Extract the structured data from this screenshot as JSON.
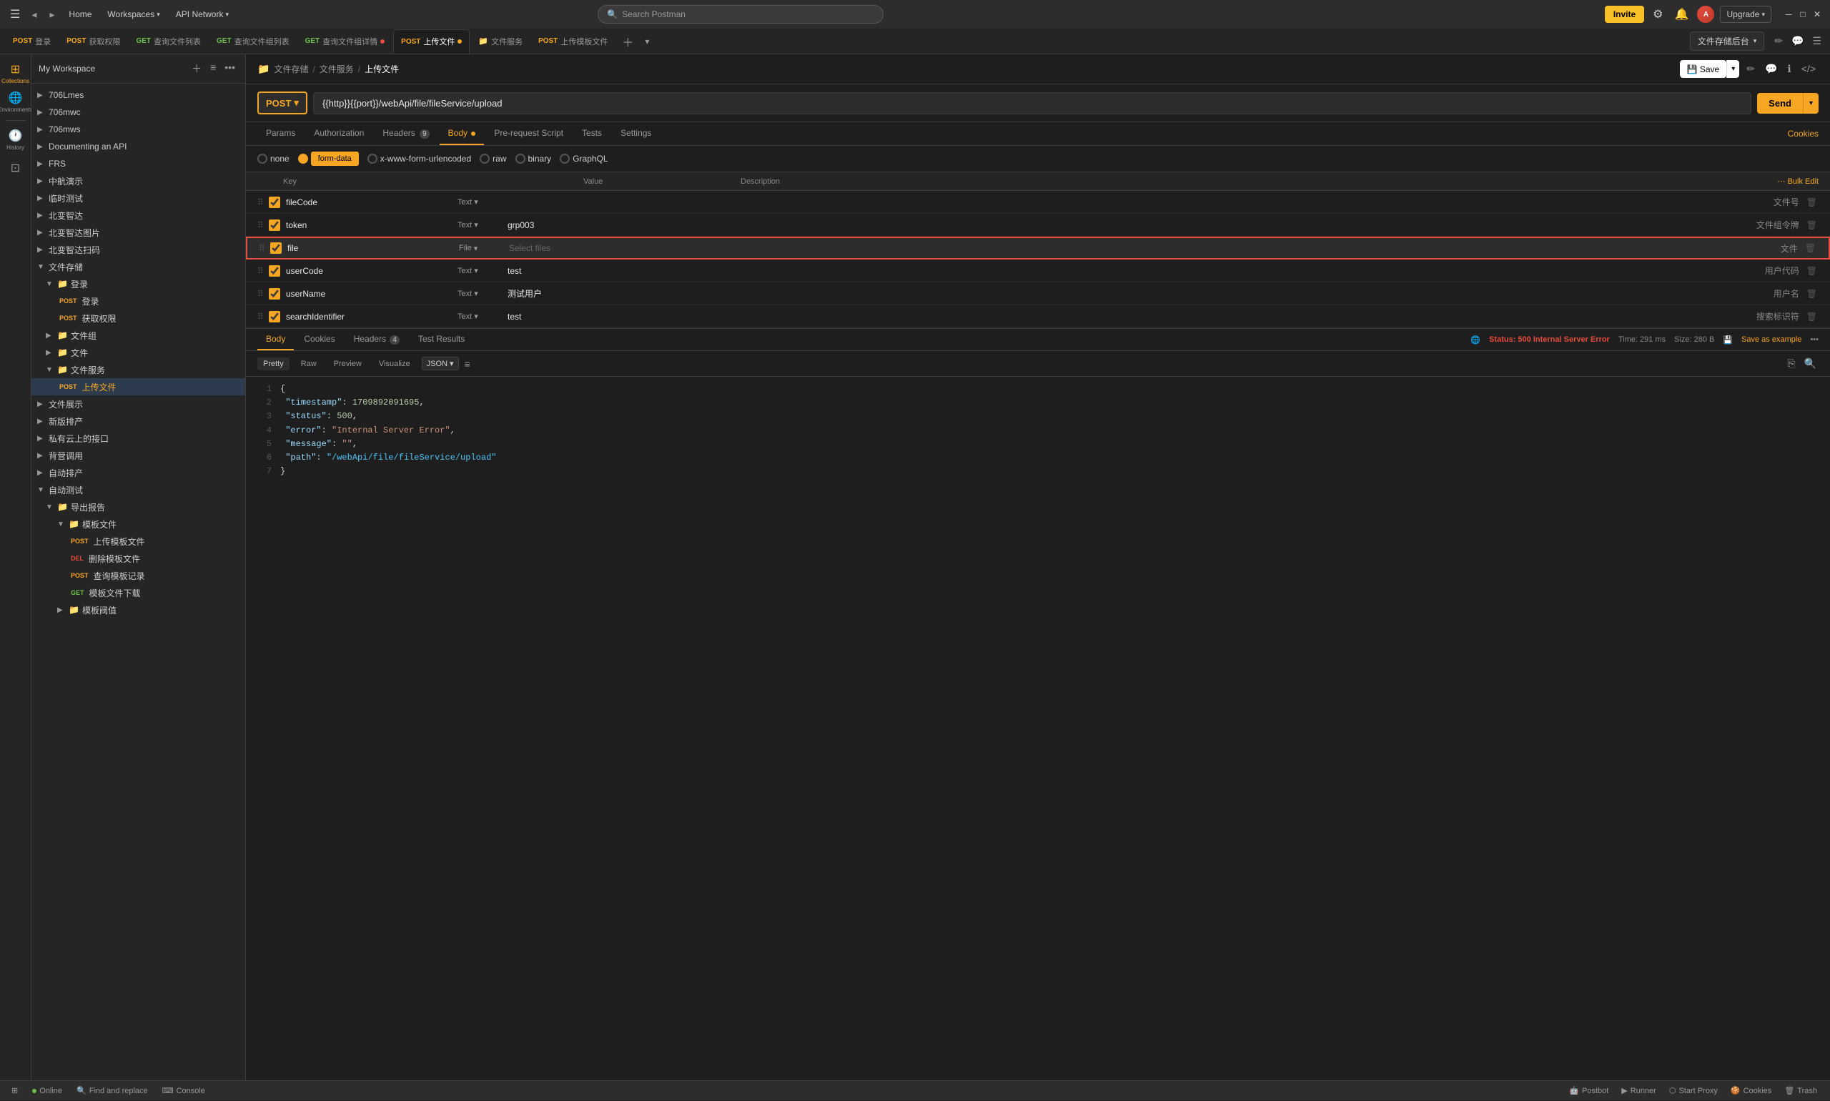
{
  "topbar": {
    "home_label": "Home",
    "workspaces_label": "Workspaces",
    "api_network_label": "API Network",
    "search_placeholder": "Search Postman",
    "invite_label": "Invite",
    "upgrade_label": "Upgrade"
  },
  "tabs": [
    {
      "method": "POST",
      "method_class": "post",
      "name": "登录",
      "active": false
    },
    {
      "method": "POST",
      "method_class": "post",
      "name": "获取权限",
      "active": false
    },
    {
      "method": "GET",
      "method_class": "get",
      "name": "查询文件列表",
      "active": false
    },
    {
      "method": "GET",
      "method_class": "get",
      "name": "查询文件组列表",
      "active": false
    },
    {
      "method": "GET",
      "method_class": "get",
      "name": "查询文件组详情",
      "active": false,
      "has_dot": true
    },
    {
      "method": "POST",
      "method_class": "post",
      "name": "上传文件",
      "active": true,
      "has_dot": true
    },
    {
      "method": "folder",
      "name": "文件服务",
      "active": false
    },
    {
      "method": "POST",
      "method_class": "post",
      "name": "上传模板文件",
      "active": false
    }
  ],
  "workspace_selector": "文件存储后台",
  "breadcrumb": {
    "icon": "📁",
    "parts": [
      "文件存储",
      "文件服务"
    ],
    "current": "上传文件"
  },
  "request": {
    "method": "POST",
    "url": "{{http}}{{port}}/webApi/file/fileService/upload",
    "send_label": "Send"
  },
  "req_tabs": [
    {
      "label": "Params",
      "active": false
    },
    {
      "label": "Authorization",
      "active": false
    },
    {
      "label": "Headers",
      "badge": "9",
      "active": false
    },
    {
      "label": "Body",
      "active": true,
      "has_dot": true
    },
    {
      "label": "Pre-request Script",
      "active": false
    },
    {
      "label": "Tests",
      "active": false
    },
    {
      "label": "Settings",
      "active": false
    }
  ],
  "cookies_label": "Cookies",
  "body_options": [
    {
      "label": "none",
      "type": "radio",
      "active": false
    },
    {
      "label": "form-data",
      "type": "form-data",
      "active": true
    },
    {
      "label": "x-www-form-urlencoded",
      "type": "radio",
      "active": false
    },
    {
      "label": "raw",
      "type": "radio",
      "active": false
    },
    {
      "label": "binary",
      "type": "radio",
      "active": false
    },
    {
      "label": "GraphQL",
      "type": "radio",
      "active": false
    }
  ],
  "table_headers": {
    "key": "Key",
    "value": "Value",
    "description": "Description",
    "bulk_edit": "Bulk Edit"
  },
  "form_rows": [
    {
      "checked": true,
      "key": "fileCode",
      "type": "Text",
      "value": "",
      "desc": "文件号",
      "highlighted": false
    },
    {
      "checked": true,
      "key": "token",
      "type": "Text",
      "value": "grp003",
      "desc": "文件组令牌",
      "highlighted": false
    },
    {
      "checked": true,
      "key": "file",
      "type": "File",
      "value": "Select files",
      "desc": "文件",
      "highlighted": true,
      "is_placeholder": true
    },
    {
      "checked": true,
      "key": "userCode",
      "type": "Text",
      "value": "test",
      "desc": "用户代码",
      "highlighted": false
    },
    {
      "checked": true,
      "key": "userName",
      "type": "Text",
      "value": "测试用户",
      "desc": "用户名",
      "highlighted": false
    },
    {
      "checked": true,
      "key": "searchIdentifier",
      "type": "Text",
      "value": "test",
      "desc": "搜索标识符",
      "highlighted": false
    }
  ],
  "response_tabs": [
    {
      "label": "Body",
      "active": true
    },
    {
      "label": "Cookies",
      "active": false
    },
    {
      "label": "Headers",
      "badge": "4",
      "active": false
    },
    {
      "label": "Test Results",
      "active": false
    }
  ],
  "response_status": {
    "status": "Status: 500 Internal Server Error",
    "time": "Time: 291 ms",
    "size": "Size: 280 B",
    "save_example": "Save as example"
  },
  "response_format_tabs": [
    {
      "label": "Pretty",
      "active": true
    },
    {
      "label": "Raw",
      "active": false
    },
    {
      "label": "Preview",
      "active": false
    },
    {
      "label": "Visualize",
      "active": false
    }
  ],
  "json_selector": "JSON",
  "response_json": [
    {
      "line": 1,
      "content": "{"
    },
    {
      "line": 2,
      "content": "  \"timestamp\": 1709892091695,"
    },
    {
      "line": 3,
      "content": "  \"status\": 500,"
    },
    {
      "line": 4,
      "content": "  \"error\": \"Internal Server Error\","
    },
    {
      "line": 5,
      "content": "  \"message\": \"\","
    },
    {
      "line": 6,
      "content": "  \"path\": \"/webApi/file/fileService/upload\""
    },
    {
      "line": 7,
      "content": "}"
    }
  ],
  "sidebar_nav": [
    {
      "label": "Collections",
      "icon": "collections",
      "active": true
    },
    {
      "label": "Environments",
      "icon": "environments",
      "active": false
    },
    {
      "label": "History",
      "icon": "history",
      "active": false
    },
    {
      "label": "Mock",
      "icon": "mock",
      "active": false
    }
  ],
  "collections_tree": [
    {
      "indent": 0,
      "type": "collection",
      "label": "706Lmes",
      "expanded": false
    },
    {
      "indent": 0,
      "type": "collection",
      "label": "706mwc",
      "expanded": false
    },
    {
      "indent": 0,
      "type": "collection",
      "label": "706mws",
      "expanded": false
    },
    {
      "indent": 0,
      "type": "collection",
      "label": "Documenting an API",
      "expanded": false
    },
    {
      "indent": 0,
      "type": "collection",
      "label": "FRS",
      "expanded": false
    },
    {
      "indent": 0,
      "type": "collection",
      "label": "中航演示",
      "expanded": false
    },
    {
      "indent": 0,
      "type": "collection",
      "label": "临时测试",
      "expanded": false
    },
    {
      "indent": 0,
      "type": "collection",
      "label": "北变智达",
      "expanded": false
    },
    {
      "indent": 0,
      "type": "collection",
      "label": "北变智达图片",
      "expanded": false
    },
    {
      "indent": 0,
      "type": "collection",
      "label": "北变智达扫码",
      "expanded": false
    },
    {
      "indent": 0,
      "type": "collection",
      "label": "文件存储",
      "expanded": true
    },
    {
      "indent": 1,
      "type": "folder",
      "label": "登录",
      "expanded": true
    },
    {
      "indent": 2,
      "type": "request",
      "method": "POST",
      "label": "登录"
    },
    {
      "indent": 2,
      "type": "request",
      "method": "POST",
      "label": "获取权限"
    },
    {
      "indent": 1,
      "type": "folder",
      "label": "文件组",
      "expanded": false
    },
    {
      "indent": 1,
      "type": "folder",
      "label": "文件",
      "expanded": false
    },
    {
      "indent": 1,
      "type": "folder",
      "label": "文件服务",
      "expanded": true
    },
    {
      "indent": 2,
      "type": "request",
      "method": "POST",
      "label": "上传文件",
      "active": true
    },
    {
      "indent": 0,
      "type": "collection",
      "label": "文件展示",
      "expanded": false
    },
    {
      "indent": 0,
      "type": "collection",
      "label": "新版排产",
      "expanded": false
    },
    {
      "indent": 0,
      "type": "collection",
      "label": "私有云上的接口",
      "expanded": false
    },
    {
      "indent": 0,
      "type": "collection",
      "label": "背营调用",
      "expanded": false
    },
    {
      "indent": 0,
      "type": "collection",
      "label": "自动排产",
      "expanded": false
    },
    {
      "indent": 0,
      "type": "collection",
      "label": "自动测试",
      "expanded": true
    },
    {
      "indent": 1,
      "type": "folder",
      "label": "导出报告",
      "expanded": true
    },
    {
      "indent": 2,
      "type": "folder",
      "label": "模板文件",
      "expanded": true
    },
    {
      "indent": 3,
      "type": "request",
      "method": "POST",
      "label": "上传模板文件"
    },
    {
      "indent": 3,
      "type": "request",
      "method": "DEL",
      "label": "删除模板文件"
    },
    {
      "indent": 3,
      "type": "request",
      "method": "POST",
      "label": "查询模板记录"
    },
    {
      "indent": 3,
      "type": "request",
      "method": "GET",
      "label": "模板文件下载"
    },
    {
      "indent": 2,
      "type": "folder",
      "label": "模板阀值",
      "expanded": false
    }
  ],
  "bottombar": {
    "online": "Online",
    "find_replace": "Find and replace",
    "console": "Console",
    "postbot": "Postbot",
    "runner": "Runner",
    "start_proxy": "Start Proxy",
    "cookies": "Cookies",
    "trash": "Trash"
  }
}
